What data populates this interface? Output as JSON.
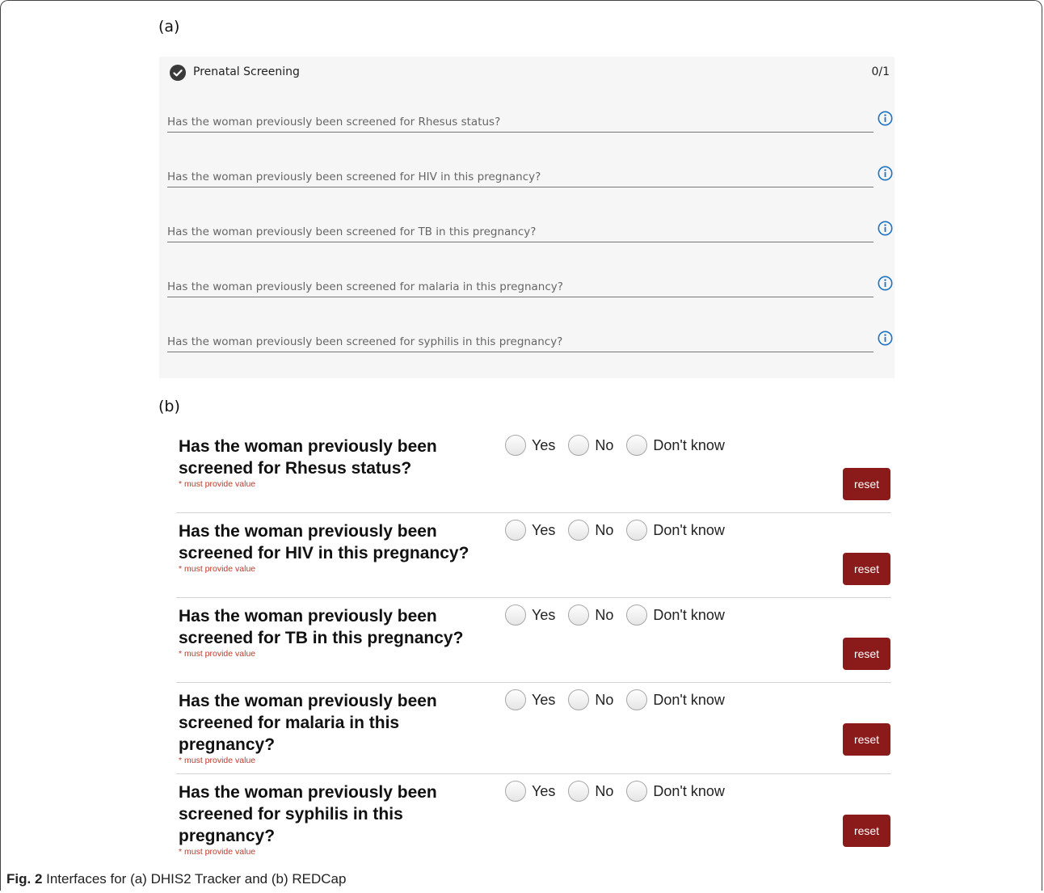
{
  "panel_a_label": "(a)",
  "panel_b_label": "(b)",
  "dhis": {
    "section_title": "Prenatal Screening",
    "section_count": "0/1",
    "fields": [
      "Has the woman previously been screened for Rhesus status?",
      "Has the woman previously been screened for HIV in this pregnancy?",
      "Has the woman previously been screened for TB in this pregnancy?",
      "Has the woman previously been screened for malaria in this pregnancy?",
      "Has the woman previously been screened for syphilis in this pregnancy?"
    ],
    "colors": {
      "background": "#f6f6f6",
      "info_icon": "#1e73be"
    }
  },
  "redcap": {
    "options": [
      "Yes",
      "No",
      "Don't know"
    ],
    "required_note": "* must provide value",
    "reset_label": "reset",
    "questions": [
      "Has the woman previously been screened for Rhesus status?",
      "Has the woman previously been screened for HIV in this pregnancy?",
      "Has the woman previously been screened for TB in this pregnancy?",
      "Has the woman previously been screened for malaria in this pregnancy?",
      "Has the woman previously been screened for syphilis in this pregnancy?"
    ],
    "colors": {
      "reset_button": "#8b1a1a",
      "required_text": "#c0392b"
    }
  },
  "caption": {
    "fig_label": "Fig. 2",
    "text": " Interfaces for (a) DHIS2 Tracker and (b) REDCap"
  }
}
